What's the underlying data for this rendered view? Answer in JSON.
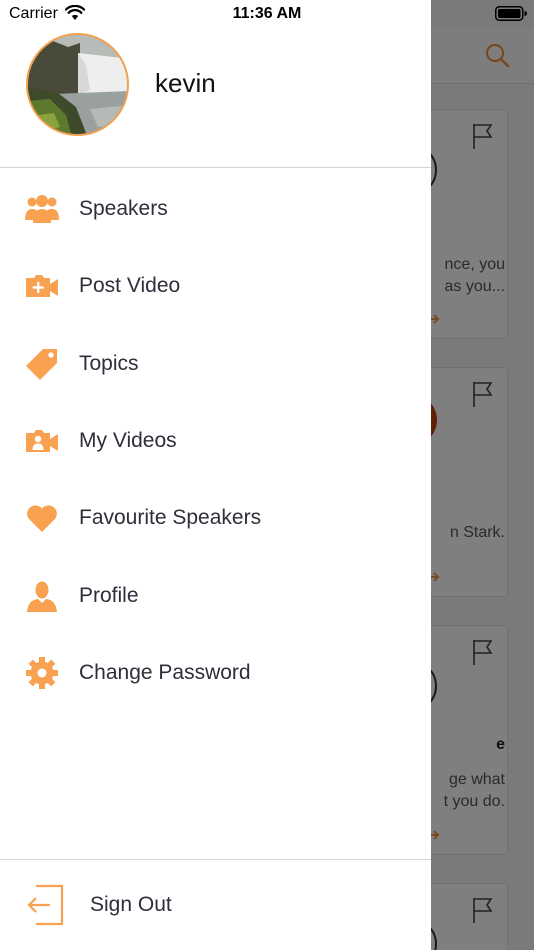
{
  "status_bar": {
    "carrier": "Carrier",
    "time": "11:36 AM"
  },
  "drawer": {
    "username": "kevin",
    "accent_color": "#f7a151",
    "menu": [
      {
        "label": "Speakers",
        "icon": "users-icon"
      },
      {
        "label": "Post Video",
        "icon": "add-video-icon"
      },
      {
        "label": "Topics",
        "icon": "tag-icon"
      },
      {
        "label": "My Videos",
        "icon": "user-video-icon"
      },
      {
        "label": "Favourite Speakers",
        "icon": "heart-icon"
      },
      {
        "label": "Profile",
        "icon": "person-icon"
      },
      {
        "label": "Change Password",
        "icon": "gear-icon"
      }
    ],
    "sign_out_label": "Sign Out"
  },
  "background": {
    "cards": [
      {
        "lines": [
          "nce, you",
          "as you..."
        ]
      },
      {
        "lines": [
          "n Stark."
        ]
      },
      {
        "title": "e",
        "lines": [
          "ge what",
          "t you do."
        ]
      }
    ]
  }
}
